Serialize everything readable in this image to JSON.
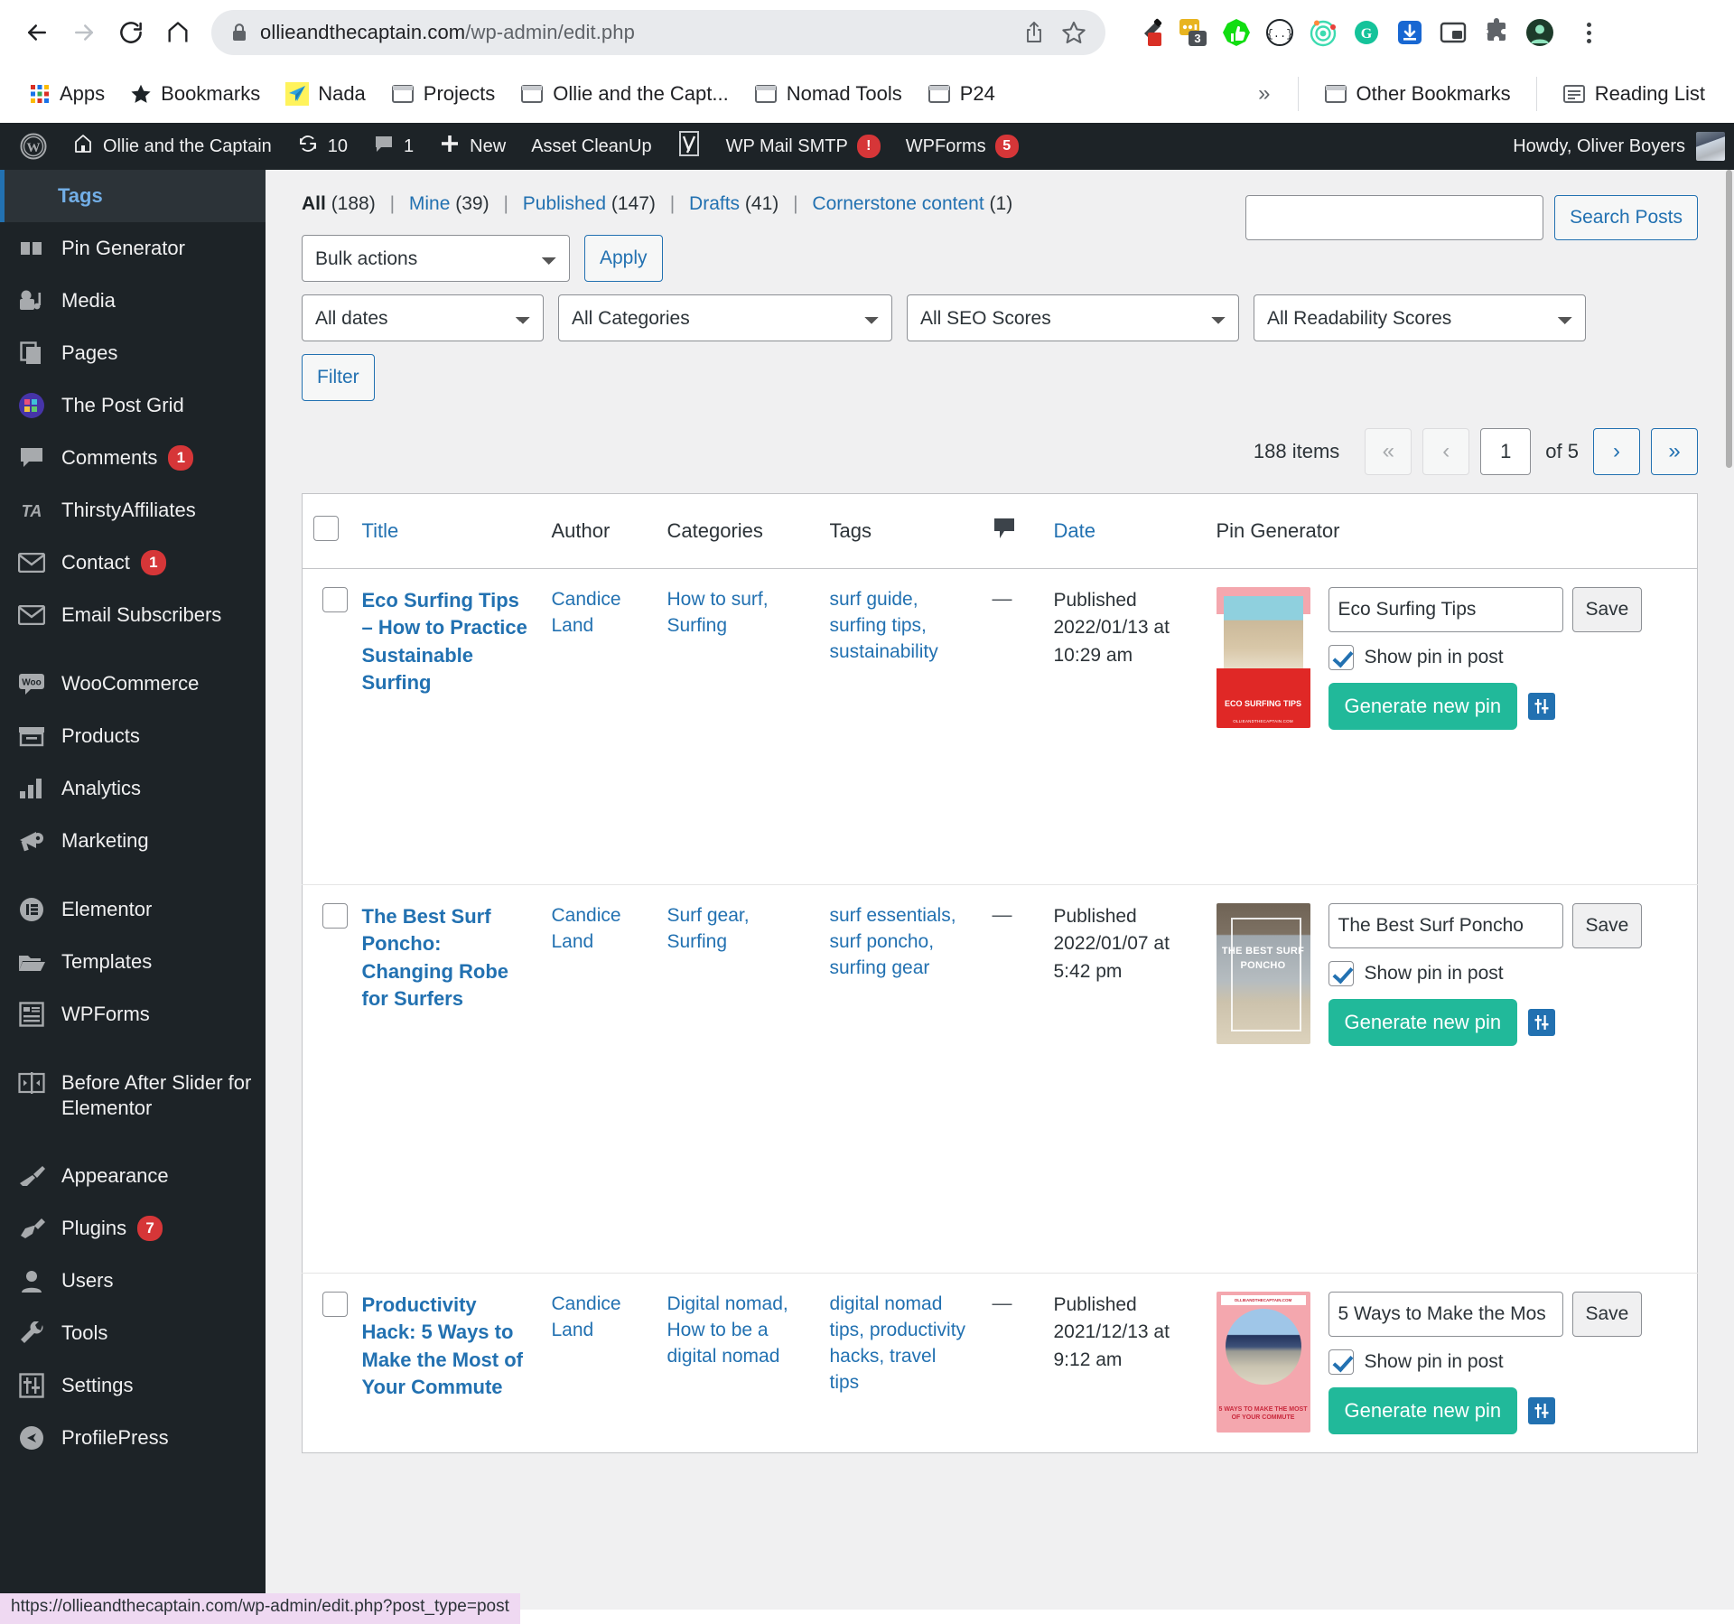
{
  "browser": {
    "url_domain": "ollieandthecaptain.com",
    "url_path": "/wp-admin/edit.php",
    "back_icon": "back-arrow-icon",
    "forward_icon": "forward-arrow-icon",
    "reload_icon": "reload-icon",
    "home_icon": "home-icon",
    "lock_icon": "lock-icon",
    "share_icon": "share-icon",
    "bookmark_star_icon": "star-icon",
    "menu_icon": "kebab-menu-icon",
    "extensions": [
      {
        "name": "eyedropper-extension-icon"
      },
      {
        "name": "notes-extension-icon",
        "badge": "3"
      },
      {
        "name": "thumbs-up-extension-icon"
      },
      {
        "name": "json-viewer-extension-icon"
      },
      {
        "name": "target-extension-icon"
      },
      {
        "name": "grammarly-extension-icon"
      },
      {
        "name": "download-extension-icon"
      },
      {
        "name": "picture-in-picture-extension-icon"
      },
      {
        "name": "puzzle-extensions-icon"
      },
      {
        "name": "profile-avatar-icon"
      }
    ],
    "bookmarks": [
      {
        "label": "Apps",
        "icon": "apps-grid-icon"
      },
      {
        "label": "Bookmarks",
        "icon": "star-icon"
      },
      {
        "label": "Nada",
        "icon": "paper-plane-icon"
      },
      {
        "label": "Projects",
        "icon": "folder-icon"
      },
      {
        "label": "Ollie and the Capt...",
        "icon": "folder-icon"
      },
      {
        "label": "Nomad Tools",
        "icon": "folder-icon"
      },
      {
        "label": "P24",
        "icon": "folder-icon"
      }
    ],
    "overflow_label": "»",
    "other_bookmarks": {
      "label": "Other Bookmarks",
      "icon": "folder-icon"
    },
    "reading_list": {
      "label": "Reading List",
      "icon": "reading-list-icon"
    }
  },
  "adminbar": {
    "wp_logo": "wordpress-logo-icon",
    "site_name": "Ollie and the Captain",
    "site_icon": "home-icon",
    "updates": {
      "icon": "updates-icon",
      "count": "10"
    },
    "comments": {
      "icon": "comment-bubble-icon",
      "count": "1"
    },
    "new": {
      "icon": "plus-icon",
      "label": "New"
    },
    "asset_cleanup": "Asset CleanUp",
    "yoast_icon": "yoast-seo-icon",
    "wp_mail_smtp": {
      "label": "WP Mail SMTP",
      "badge": "!"
    },
    "wpforms": {
      "label": "WPForms",
      "badge": "5"
    },
    "howdy": "Howdy, Oliver Boyers",
    "avatar": "user-avatar"
  },
  "sidebar": {
    "current": "Tags",
    "items": [
      {
        "label": "Pin Generator",
        "icon": "pin-generator-icon"
      },
      {
        "label": "Media",
        "icon": "media-icon"
      },
      {
        "label": "Pages",
        "icon": "pages-icon"
      },
      {
        "label": "The Post Grid",
        "icon": "post-grid-icon"
      },
      {
        "label": "Comments",
        "icon": "comments-icon",
        "badge": "1"
      },
      {
        "label": "ThirstyAffiliates",
        "icon": "thirstyaffiliates-icon"
      },
      {
        "label": "Contact",
        "icon": "envelope-icon",
        "badge": "1"
      },
      {
        "label": "Email Subscribers",
        "icon": "envelope-icon"
      },
      {
        "sep": true
      },
      {
        "label": "WooCommerce",
        "icon": "woocommerce-icon"
      },
      {
        "label": "Products",
        "icon": "products-icon"
      },
      {
        "label": "Analytics",
        "icon": "analytics-icon"
      },
      {
        "label": "Marketing",
        "icon": "megaphone-icon"
      },
      {
        "sep": true
      },
      {
        "label": "Elementor",
        "icon": "elementor-icon"
      },
      {
        "label": "Templates",
        "icon": "folder-open-icon"
      },
      {
        "label": "WPForms",
        "icon": "wpforms-icon"
      },
      {
        "sep": true
      },
      {
        "label": "Before After Slider for Elementor",
        "icon": "before-after-slider-icon"
      },
      {
        "sep": true
      },
      {
        "label": "Appearance",
        "icon": "paintbrush-icon"
      },
      {
        "label": "Plugins",
        "icon": "plug-icon",
        "badge": "7"
      },
      {
        "label": "Users",
        "icon": "user-icon"
      },
      {
        "label": "Tools",
        "icon": "wrench-icon"
      },
      {
        "label": "Settings",
        "icon": "sliders-icon"
      },
      {
        "label": "ProfilePress",
        "icon": "profilepress-icon"
      }
    ]
  },
  "filters": {
    "views": [
      {
        "label": "All",
        "count": "(188)",
        "current": true
      },
      {
        "label": "Mine",
        "count": "(39)"
      },
      {
        "label": "Published",
        "count": "(147)"
      },
      {
        "label": "Drafts",
        "count": "(41)"
      },
      {
        "label": "Cornerstone content",
        "count": "(1)"
      }
    ],
    "bulk_actions": "Bulk actions",
    "apply_label": "Apply",
    "all_dates": "All dates",
    "all_categories": "All Categories",
    "all_seo": "All SEO Scores",
    "all_readability": "All Readability Scores",
    "filter_label": "Filter"
  },
  "search": {
    "value": "",
    "placeholder": "",
    "button_label": "Search Posts"
  },
  "pagination": {
    "items_label": "188 items",
    "first": "«",
    "prev": "‹",
    "current_page": "1",
    "of_label": "of 5",
    "next": "›",
    "last": "»"
  },
  "table": {
    "columns": {
      "title": "Title",
      "author": "Author",
      "categories": "Categories",
      "tags": "Tags",
      "comments_icon": "comment-bubble-icon",
      "date": "Date",
      "pin_generator": "Pin Generator"
    },
    "rows": [
      {
        "title": "Eco Surfing Tips – How to Practice Sustainable Surfing",
        "author": "Candice Land",
        "categories": "How to surf, Surfing",
        "tags": "surf guide, surfing tips, sustainability",
        "comments": "—",
        "date": "Published 2022/01/13 at 10:29 am",
        "pin": {
          "title_value": "Eco Surfing Tips",
          "show_pin_label": "Show pin in post",
          "show_pin_checked": true,
          "save_label": "Save",
          "generate_label": "Generate new pin",
          "settings_icon": "sliders-icon",
          "thumb_text": "ECO SURFING TIPS",
          "thumb_domain": "OLLIEANDTHECAPTAIN.COM"
        }
      },
      {
        "title": "The Best Surf Poncho: Changing Robe for Surfers",
        "author": "Candice Land",
        "categories": "Surf gear, Surfing",
        "tags": "surf essentials, surf poncho, surfing gear",
        "comments": "—",
        "date": "Published 2022/01/07 at 5:42 pm",
        "pin": {
          "title_value": "The Best Surf Poncho",
          "show_pin_label": "Show pin in post",
          "show_pin_checked": true,
          "save_label": "Save",
          "generate_label": "Generate new pin",
          "settings_icon": "sliders-icon",
          "thumb_text": "THE BEST SURF PONCHO",
          "thumb_domain": ""
        }
      },
      {
        "title": "Productivity Hack: 5 Ways to Make the Most of Your Commute",
        "author": "Candice Land",
        "categories": "Digital nomad, How to be a digital nomad",
        "tags": "digital nomad tips, productivity hacks, travel tips",
        "comments": "—",
        "date": "Published 2021/12/13 at 9:12 am",
        "pin": {
          "title_value": "5 Ways to Make the Mos",
          "show_pin_label": "Show pin in post",
          "show_pin_checked": true,
          "save_label": "Save",
          "generate_label": "Generate new pin",
          "settings_icon": "sliders-icon",
          "thumb_text": "5 WAYS TO MAKE THE MOST OF YOUR COMMUTE",
          "thumb_domain": "OLLIEANDTHECAPTAIN.COM"
        }
      }
    ]
  },
  "statusbar": "https://ollieandthecaptain.com/wp-admin/edit.php?post_type=post",
  "colors": {
    "accent_blue": "#2271b1",
    "admin_dark": "#1d2327",
    "badge_red": "#d63638",
    "generate_teal": "#21b99a",
    "page_bg": "#f0f0f1"
  }
}
